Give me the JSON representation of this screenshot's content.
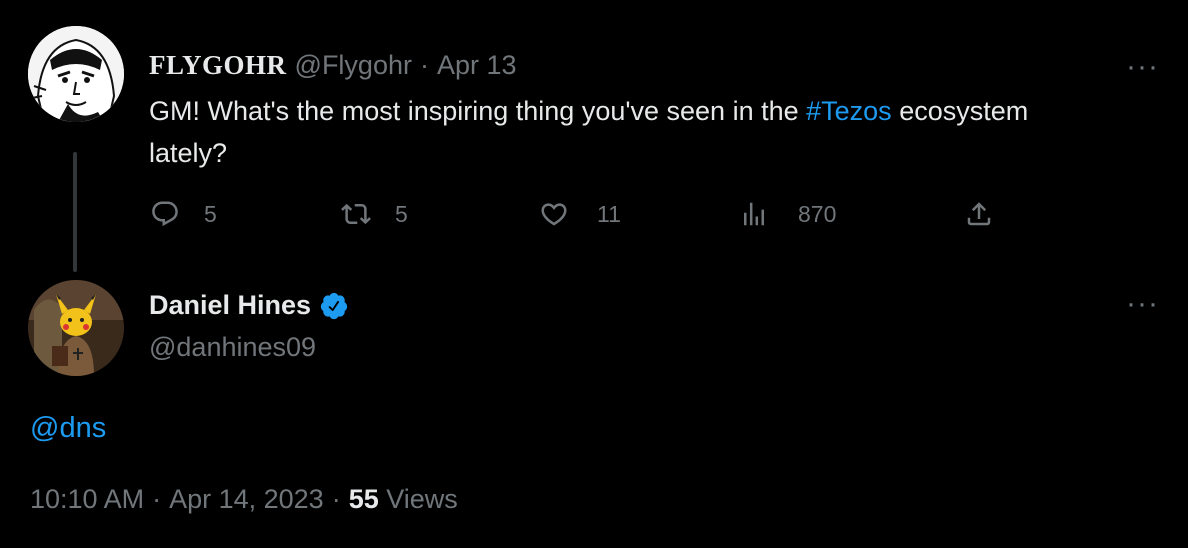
{
  "colors": {
    "background": "#000000",
    "text": "#e7e9ea",
    "muted": "#71767b",
    "link": "#1d9bf0",
    "verified": "#1d9bf0"
  },
  "parent_tweet": {
    "display_name": "FLYGOHR",
    "handle": "@Flygohr",
    "separator": "·",
    "date": "Apr 13",
    "text_before": "GM! What's the most inspiring thing you've seen in the ",
    "hashtag": "#Tezos",
    "text_after_line1": " ecosystem",
    "text_line2": "lately?",
    "more_label": "···",
    "actions": {
      "reply_icon": "reply-icon",
      "reply_count": "5",
      "retweet_icon": "retweet-icon",
      "retweet_count": "5",
      "like_icon": "heart-icon",
      "like_count": "11",
      "views_icon": "analytics-icon",
      "views_count": "870",
      "share_icon": "share-icon"
    }
  },
  "reply_tweet": {
    "display_name": "Daniel Hines",
    "verified_icon": "verified-badge-icon",
    "handle": "@danhines09",
    "more_label": "···",
    "mention": "@dns",
    "time": "10:10 AM",
    "sep1": "·",
    "date": "Apr 14, 2023",
    "sep2": "·",
    "views_count": "55",
    "views_label": "Views"
  }
}
